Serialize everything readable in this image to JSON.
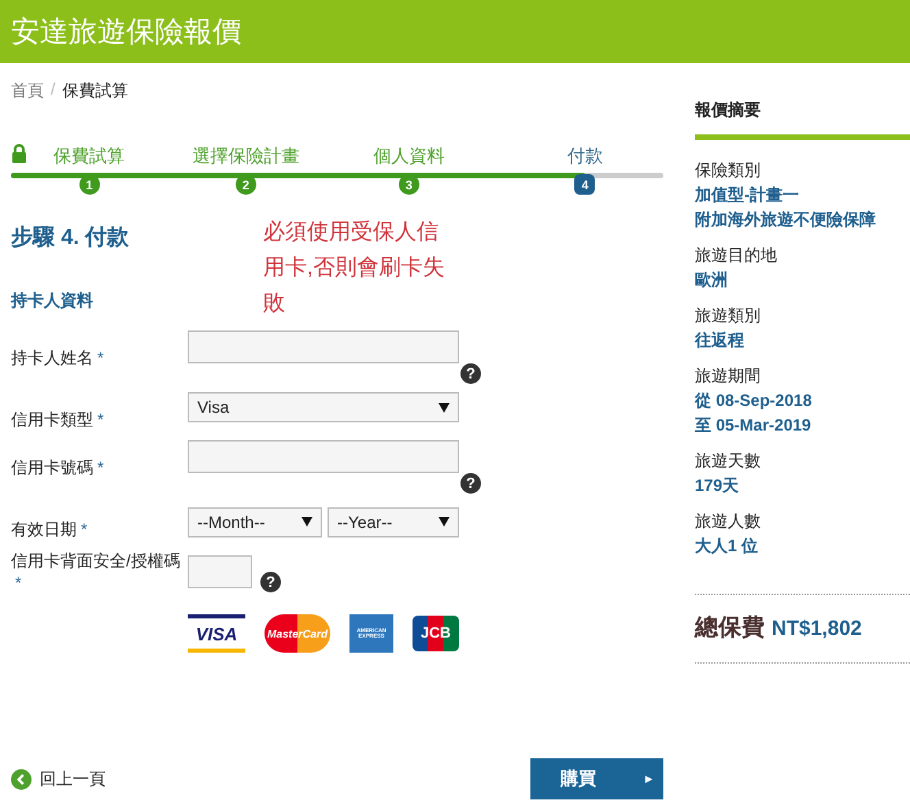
{
  "header": {
    "title": "安達旅遊保險報價"
  },
  "breadcrumb": [
    {
      "label": "首頁",
      "selected": false
    },
    {
      "label": "保費試算",
      "selected": true
    }
  ],
  "breadcrumb_separator": "/",
  "steps": [
    {
      "label": "保費試算",
      "number": "1",
      "selected": false
    },
    {
      "label": "選擇保險計畫",
      "number": "2",
      "selected": false
    },
    {
      "label": "個人資料",
      "number": "3",
      "selected": false
    },
    {
      "label": "付款",
      "number": "4",
      "selected": true
    }
  ],
  "step_title": "步驟 4. 付款",
  "notice": "必須使用受保人信用卡,否則會刷卡失敗",
  "section_title": "持卡人資料",
  "fields": [
    {
      "kind": "input",
      "label": "持卡人姓名",
      "required_mark": "*",
      "help": "?"
    },
    {
      "kind": "select",
      "label": "信用卡類型",
      "required_mark": "*",
      "value": "Visa"
    },
    {
      "kind": "input",
      "label": "信用卡號碼",
      "required_mark": "*",
      "help": "?"
    },
    {
      "kind": "date",
      "label": "有效日期",
      "required_mark": "*",
      "values": [
        "--Month--",
        "--Year--"
      ]
    },
    {
      "kind": "short",
      "label": "信用卡背面安全/授權碼",
      "required_mark": "*",
      "help": "?"
    }
  ],
  "cards": [
    {
      "kind": "visa",
      "label": "VISA"
    },
    {
      "kind": "mastercard",
      "label": "MasterCard"
    },
    {
      "kind": "amex",
      "label": "AMERICAN EXPRESS"
    },
    {
      "kind": "jcb",
      "label": "JCB"
    }
  ],
  "back_link": "回上一頁",
  "buy_button": {
    "label": "購買",
    "arrow": "►"
  },
  "summary": {
    "title": "報價摘要",
    "items": [
      {
        "label": "保險類別",
        "values": [
          "加值型-計畫一",
          "附加海外旅遊不便險保障"
        ]
      },
      {
        "label": "旅遊目的地",
        "values": [
          "歐洲"
        ]
      },
      {
        "label": "旅遊類別",
        "values": [
          "往返程"
        ]
      },
      {
        "label": "旅遊期間",
        "values": [
          "從 08-Sep-2018",
          "至 05-Mar-2019"
        ]
      },
      {
        "label": "旅遊天數",
        "values": [
          "179天"
        ]
      },
      {
        "label": "旅遊人數",
        "values": [
          "大人1 位"
        ]
      }
    ],
    "total_label": "總保費",
    "total_value": "NT$1,802"
  }
}
